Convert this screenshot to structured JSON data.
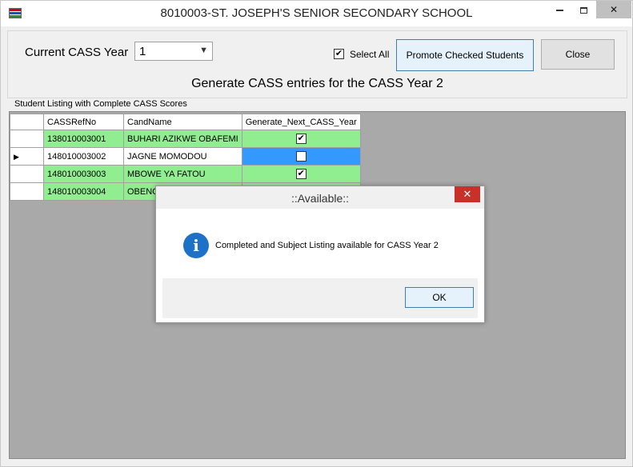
{
  "window": {
    "title": "8010003-ST. JOSEPH'S SENIOR SECONDARY SCHOOL",
    "close_glyph": "✕"
  },
  "form": {
    "current_year_label": "Current CASS Year",
    "current_year_value": "1",
    "select_all_label": "Select All",
    "select_all_checked": true,
    "promote_label": "Promote Checked Students",
    "close_label": "Close",
    "heading": "Generate CASS entries for the CASS Year 2",
    "listing_label": "Student Listing with Complete CASS Scores"
  },
  "grid": {
    "columns": [
      "CASSRefNo",
      "CandName",
      "Generate_Next_CASS_Year"
    ],
    "rows": [
      {
        "ref": "138010003001",
        "name": "BUHARI AZIKWE OBAFEMI",
        "checked": "✔"
      },
      {
        "ref": "148010003002",
        "name": "JAGNE MOMODOU",
        "checked": ""
      },
      {
        "ref": "148010003003",
        "name": "MBOWE YA FATOU",
        "checked": "✔"
      },
      {
        "ref": "148010003004",
        "name": "OBENG",
        "checked": ""
      }
    ],
    "row_indicator": "▶",
    "colors": {
      "green": "#90ee90",
      "selected": "#3399ff",
      "background": "#a9a9a9"
    }
  },
  "dialog": {
    "title": "::Available::",
    "message": "Completed and Subject Listing available for CASS Year 2",
    "ok_label": "OK",
    "icon": "info-icon"
  }
}
